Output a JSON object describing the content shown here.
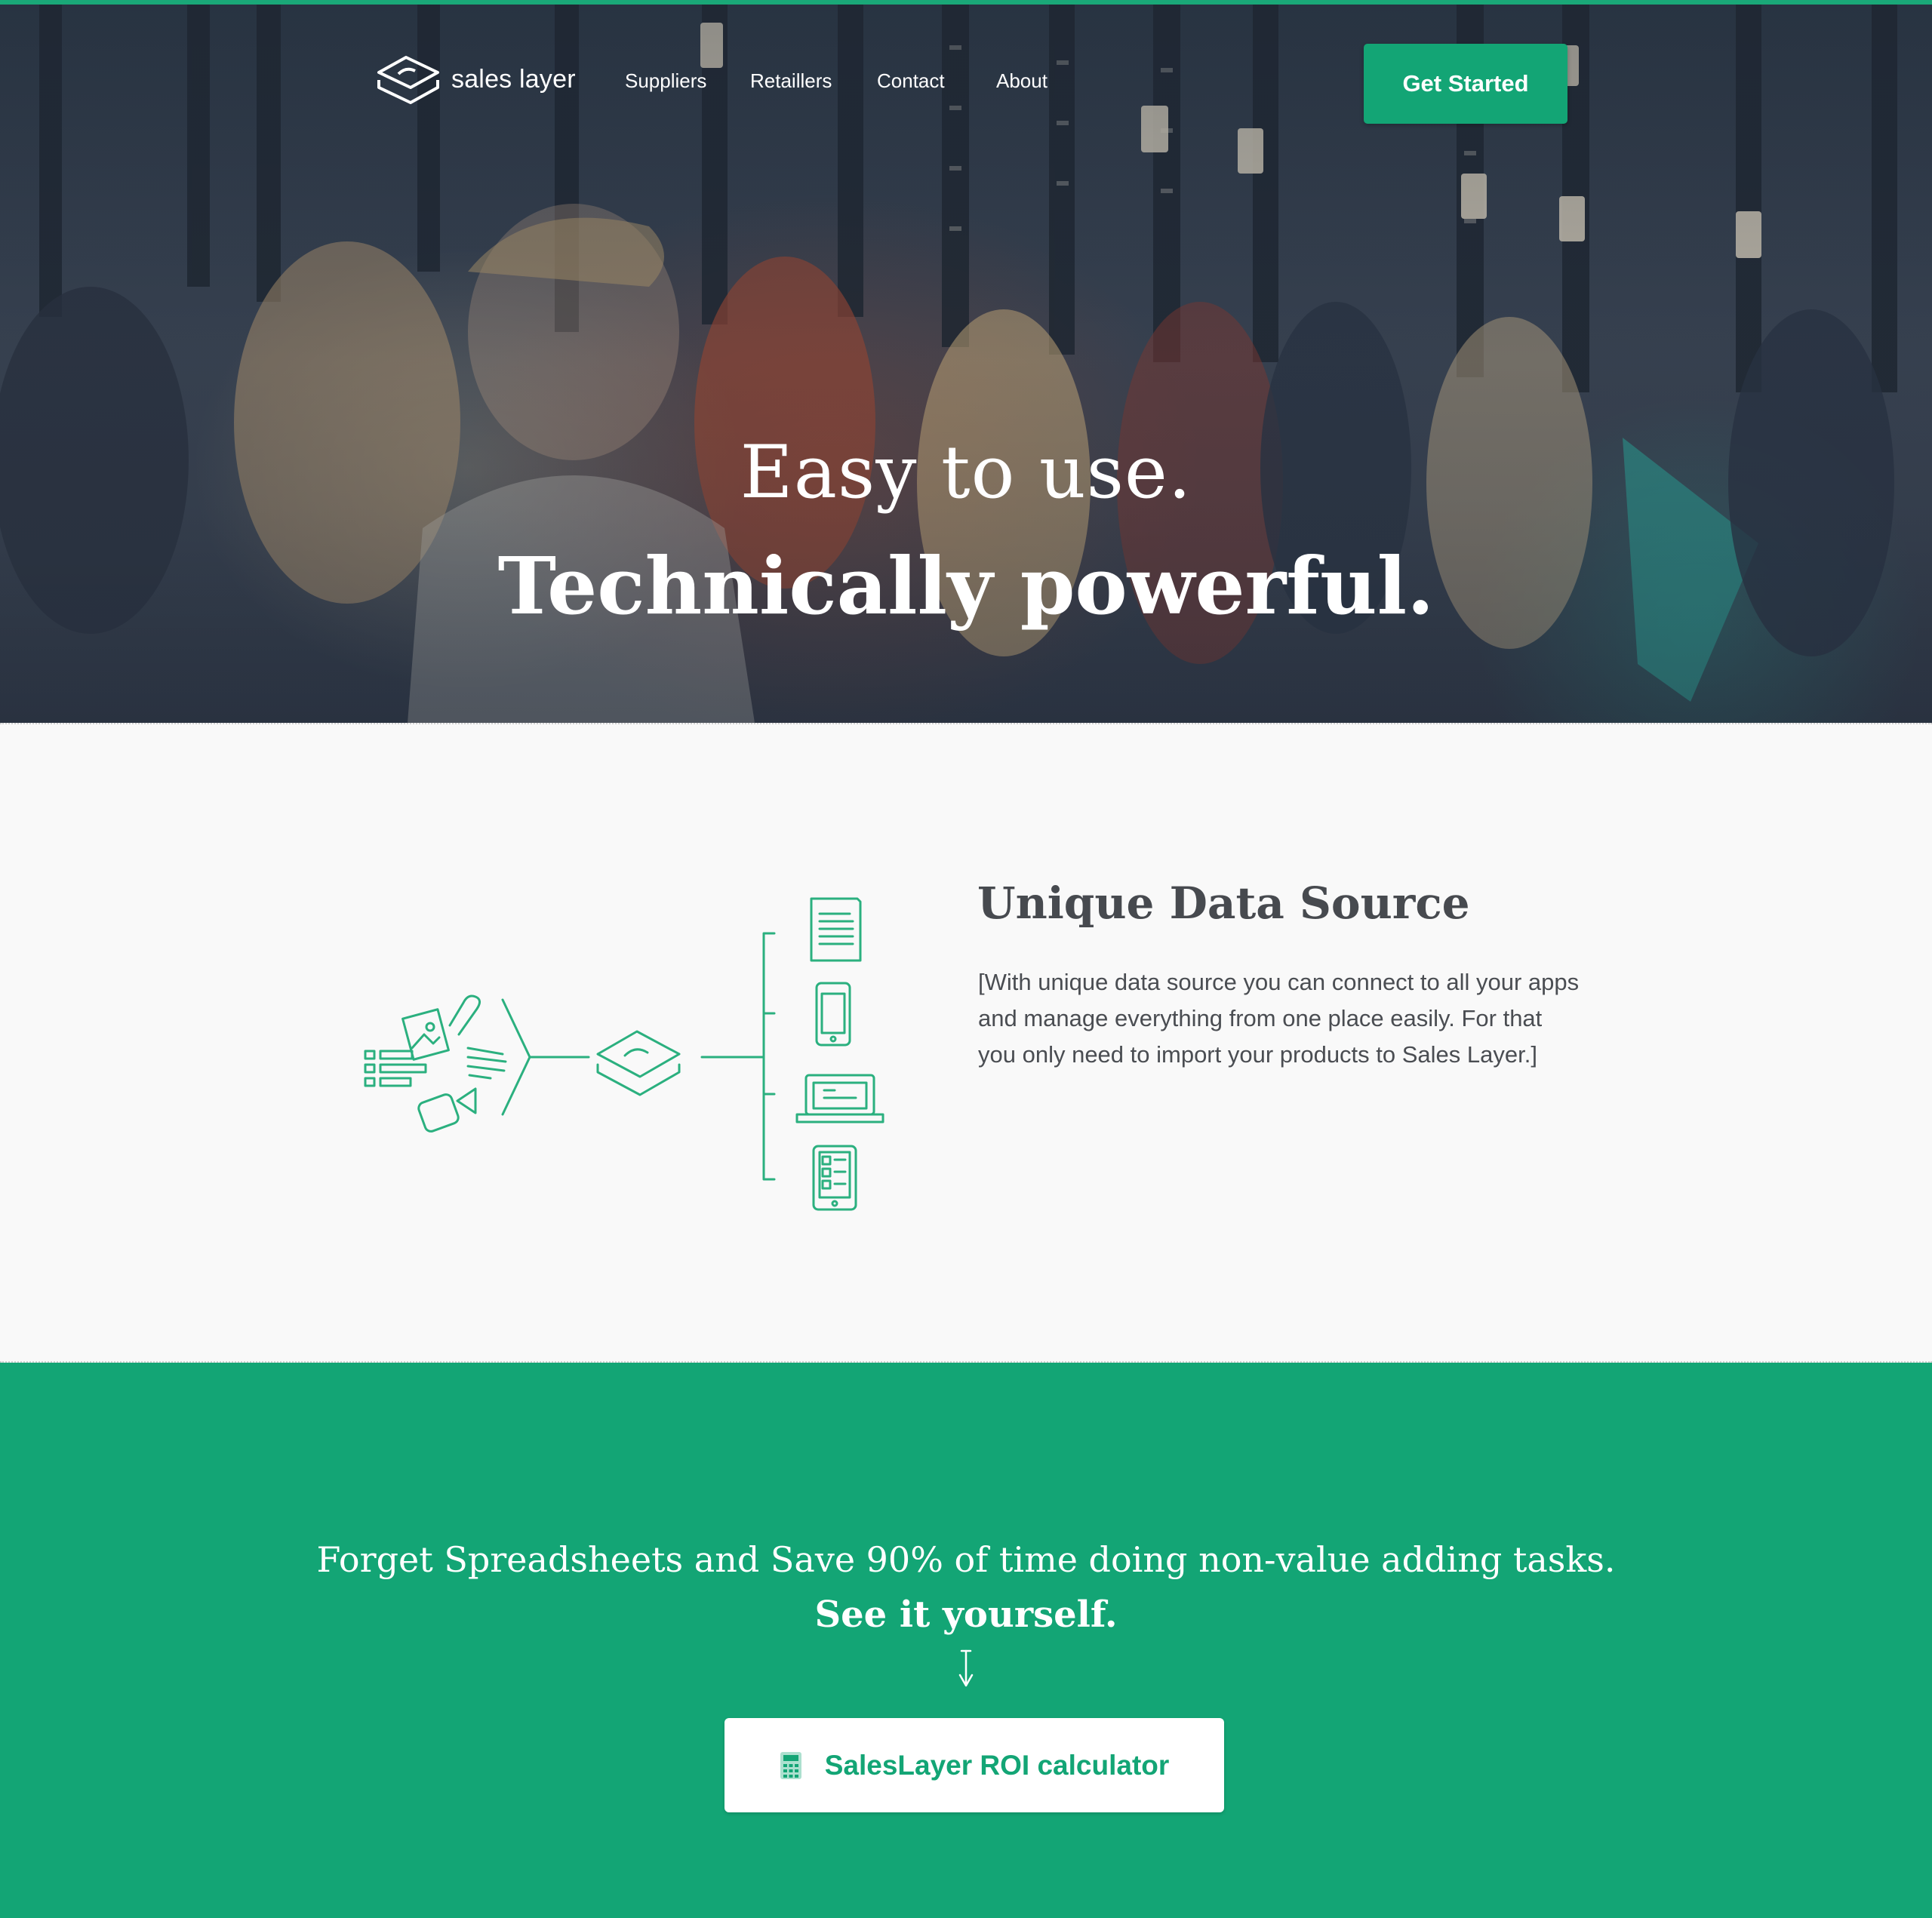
{
  "brand": {
    "name": "sales layer"
  },
  "nav": {
    "links": [
      "Suppliers",
      "Retaillers",
      "Contact",
      "About"
    ],
    "cta_label": "Get Started"
  },
  "hero": {
    "line1": "Easy to use.",
    "line2": "Technically powerful."
  },
  "feature": {
    "title": "Unique Data Source",
    "body": "[With unique data source you can connect to all your apps and manage everything from one place easily. For that you only need to import your products to Sales Layer.]"
  },
  "promo": {
    "line1": "Forget Spreadsheets and Save 90% of time doing non-value adding tasks.",
    "line2": "See it yourself.",
    "button_label": "SalesLayer ROI calculator",
    "button_icon": "calculator-icon"
  },
  "colors": {
    "accent": "#13a575",
    "text_dark": "#474a4f",
    "feature_bg": "#f9f9f9"
  }
}
